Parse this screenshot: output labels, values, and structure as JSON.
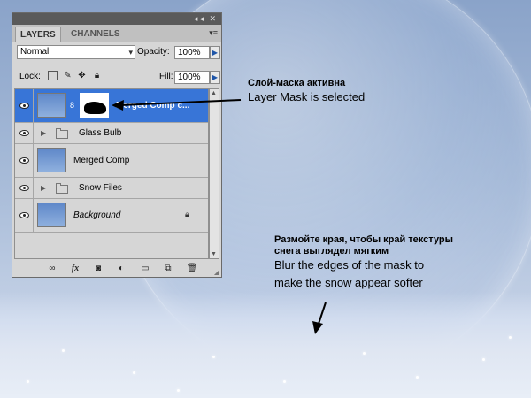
{
  "panel": {
    "title_buttons": "◂◂ ✕",
    "tabs": [
      {
        "label": "LAYERS",
        "active": true
      },
      {
        "label": "CHANNELS",
        "active": false
      }
    ],
    "menu_icon": "▾≡",
    "blend_mode": "Normal",
    "opacity_label": "Opacity:",
    "opacity_value": "100%",
    "lock_label": "Lock:",
    "fill_label": "Fill:",
    "fill_value": "100%"
  },
  "layers": [
    {
      "name": "Merged Comp c...",
      "type": "layer-with-mask",
      "selected": true,
      "visible": true
    },
    {
      "name": "Glass Bulb",
      "type": "group",
      "selected": false,
      "visible": true
    },
    {
      "name": "Merged Comp",
      "type": "layer",
      "selected": false,
      "visible": true
    },
    {
      "name": "Snow Files",
      "type": "group",
      "selected": false,
      "visible": true
    },
    {
      "name": "Background",
      "type": "background",
      "selected": false,
      "visible": true,
      "locked": true
    }
  ],
  "bottom_icons": [
    "link-icon",
    "fx-icon",
    "add-mask-icon",
    "adjustment-icon",
    "new-group-icon",
    "new-layer-icon",
    "trash-icon"
  ],
  "bottom_labels": {
    "fx": "fx"
  },
  "annotations": {
    "mask_ru": "Слой-маска активна",
    "mask_en": "Layer Mask is selected",
    "blur_ru_line1": "Размойте края, чтобы край текстуры",
    "blur_ru_line2": "снега выглядел мягким",
    "blur_en_line1": "Blur the edges of the mask to",
    "blur_en_line2": "make the snow appear softer"
  },
  "colors": {
    "selection": "#3875d7",
    "panel_bg": "#d6d6d6",
    "titlebar": "#5a5a5a"
  }
}
